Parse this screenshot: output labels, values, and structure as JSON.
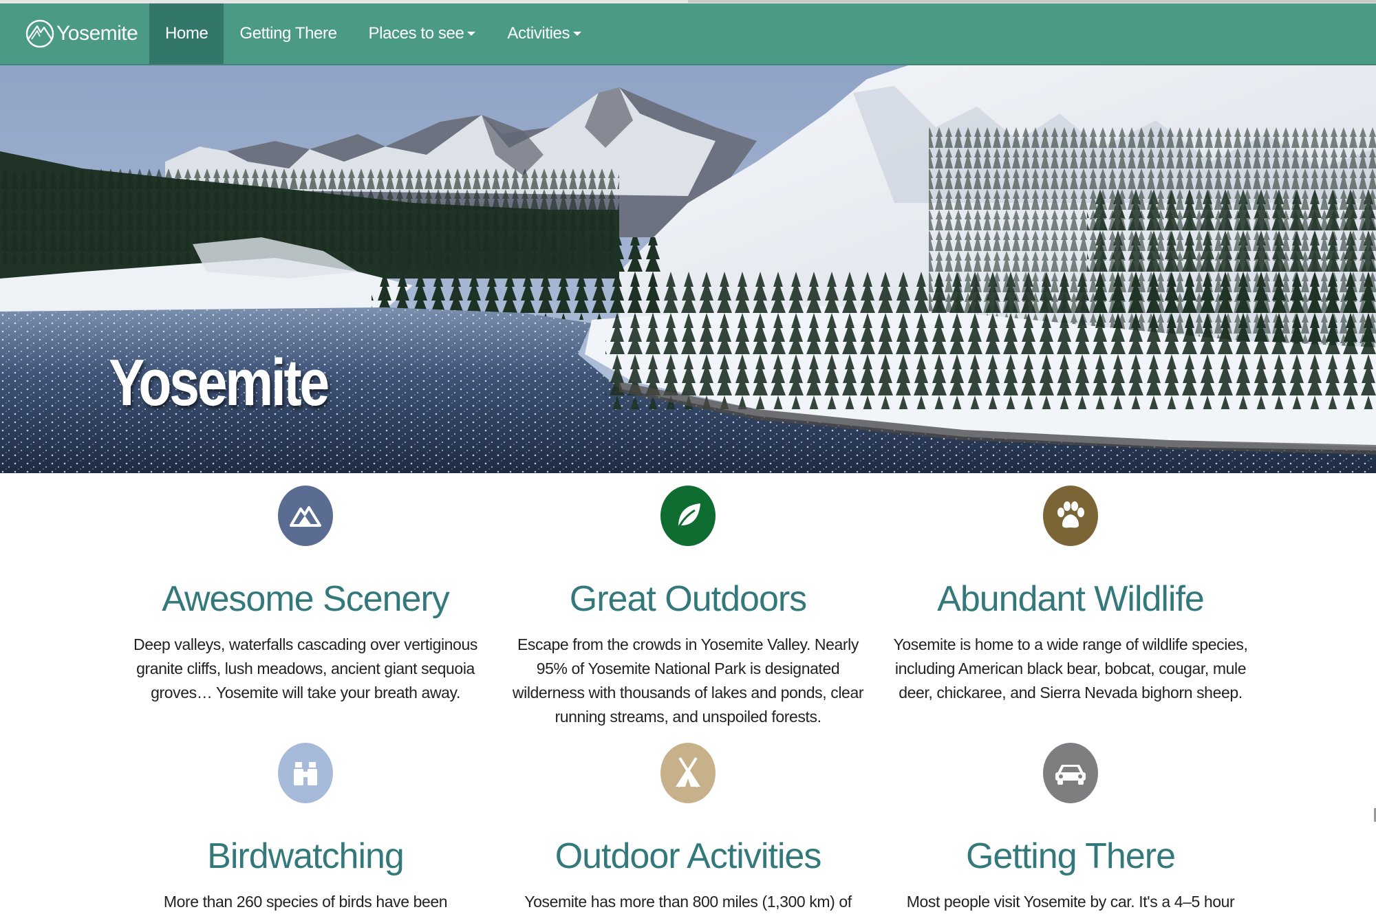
{
  "navbar": {
    "brand": "Yosemite",
    "items": [
      {
        "label": "Home",
        "active": true
      },
      {
        "label": "Getting There"
      },
      {
        "label": "Places to see",
        "dropdown": true
      },
      {
        "label": "Activities",
        "dropdown": true
      }
    ],
    "color": "#4a9a86",
    "active_color": "#327769"
  },
  "hero": {
    "title": "Yosemite"
  },
  "features": [
    {
      "icon": "mountain-icon",
      "icon_color": "#5b6c92",
      "title": "Awesome Scenery",
      "text": "Deep valleys, waterfalls cascading over vertiginous granite cliffs, lush meadows, ancient giant sequoia groves… Yosemite will take your breath away."
    },
    {
      "icon": "leaf-icon",
      "icon_color": "#0f6d32",
      "title": "Great Outdoors",
      "text": "Escape from the crowds in Yosemite Valley. Nearly 95% of Yosemite National Park is designated wilderness with thousands of lakes and ponds, clear running streams, and unspoiled forests."
    },
    {
      "icon": "paw-icon",
      "icon_color": "#7b6537",
      "title": "Abundant Wildlife",
      "text": "Yosemite is home to a wide range of wildlife species, including American black bear, bobcat, cougar, mule deer, chickaree, and Sierra Nevada bighorn sheep."
    },
    {
      "icon": "binoculars-icon",
      "icon_color": "#a8bad9",
      "title": "Birdwatching",
      "text": "More than 260 species of birds have been"
    },
    {
      "icon": "tent-icon",
      "icon_color": "#c6b18a",
      "title": "Outdoor Activities",
      "text": "Yosemite has more than 800 miles (1,300 km) of"
    },
    {
      "icon": "car-icon",
      "icon_color": "#7e7e80",
      "title": "Getting There",
      "text": "Most people visit Yosemite by car. It's a 4–5 hour"
    }
  ]
}
